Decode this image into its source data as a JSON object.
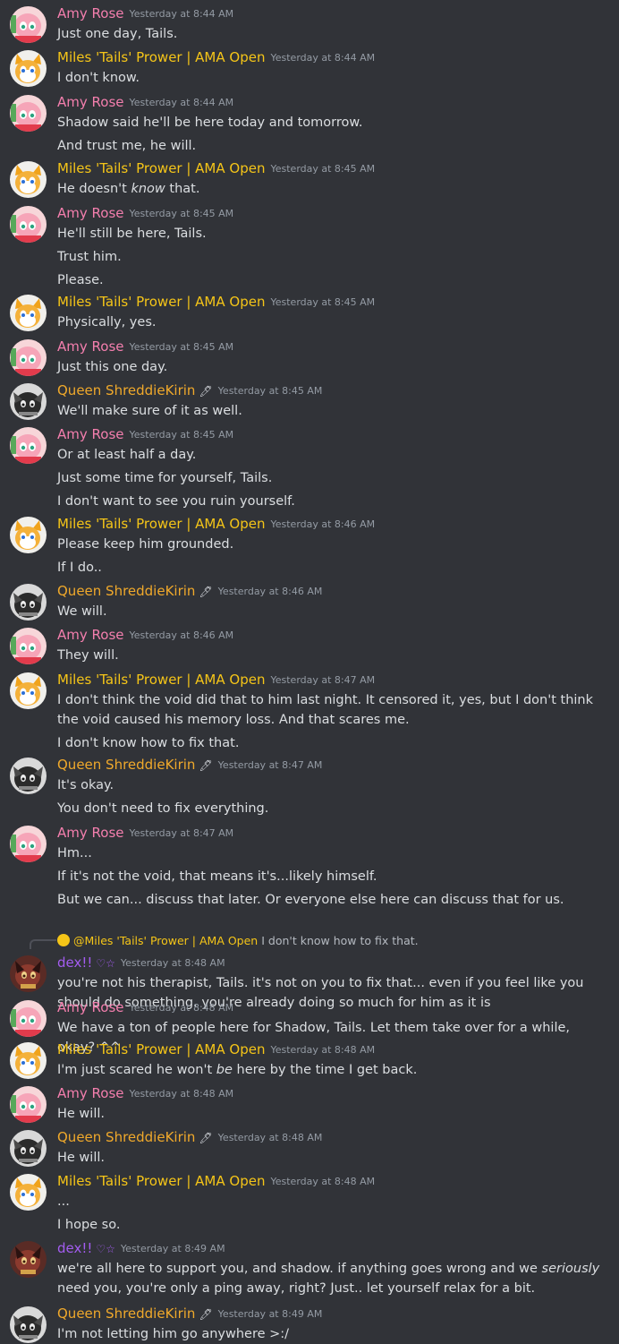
{
  "messages": [
    {
      "author": "Amy Rose",
      "role": "amy",
      "time": "Yesterday at 8:44 AM",
      "lines": [
        "Just one day, Tails."
      ]
    },
    {
      "author": "Miles 'Tails' Prower | AMA Open",
      "role": "tails",
      "time": "Yesterday at 8:44 AM",
      "lines": [
        "I don't know."
      ]
    },
    {
      "author": "Amy Rose",
      "role": "amy",
      "time": "Yesterday at 8:44 AM",
      "lines": [
        "Shadow said he'll be here today and tomorrow.",
        "And trust me, he will."
      ]
    },
    {
      "author": "Miles 'Tails' Prower | AMA Open",
      "role": "tails",
      "time": "Yesterday at 8:45 AM",
      "lines": [
        "He doesn't |know| that."
      ]
    },
    {
      "author": "Amy Rose",
      "role": "amy",
      "time": "Yesterday at 8:45 AM",
      "lines": [
        "He'll still be here, Tails.",
        "Trust him.",
        "Please."
      ]
    },
    {
      "author": "Miles 'Tails' Prower | AMA Open",
      "role": "tails",
      "time": "Yesterday at 8:45 AM",
      "lines": [
        "Physically, yes."
      ]
    },
    {
      "author": "Amy Rose",
      "role": "amy",
      "time": "Yesterday at 8:45 AM",
      "lines": [
        "Just this one day."
      ]
    },
    {
      "author": "Queen ShreddieKirin",
      "role": "queen",
      "badge": "🖊",
      "time": "Yesterday at 8:45 AM",
      "lines": [
        "We'll make sure of it as well."
      ]
    },
    {
      "author": "Amy Rose",
      "role": "amy",
      "time": "Yesterday at 8:45 AM",
      "lines": [
        "Or at least half a day.",
        "Just some time for yourself, Tails.",
        "I don't want to see you ruin yourself."
      ]
    },
    {
      "author": "Miles 'Tails' Prower | AMA Open",
      "role": "tails",
      "time": "Yesterday at 8:46 AM",
      "lines": [
        "Please keep him grounded.",
        "If I do.."
      ]
    },
    {
      "author": "Queen ShreddieKirin",
      "role": "queen",
      "badge": "🖊",
      "time": "Yesterday at 8:46 AM",
      "lines": [
        "We will."
      ]
    },
    {
      "author": "Amy Rose",
      "role": "amy",
      "time": "Yesterday at 8:46 AM",
      "lines": [
        "They will."
      ]
    },
    {
      "author": "Miles 'Tails' Prower | AMA Open",
      "role": "tails",
      "time": "Yesterday at 8:47 AM",
      "lines": [
        "I don't think the void did that to him last night. It censored it, yes, but I don't think the void caused his memory loss. And that scares me.",
        "I don't know how to fix that."
      ]
    },
    {
      "author": "Queen ShreddieKirin",
      "role": "queen",
      "badge": "🖊",
      "time": "Yesterday at 8:47 AM",
      "lines": [
        "It's okay.",
        "You don't need to fix everything."
      ]
    },
    {
      "author": "Amy Rose",
      "role": "amy",
      "time": "Yesterday at 8:47 AM",
      "lines": [
        "Hm...",
        "If it's not the void, that means it's...likely himself.",
        "But we can... discuss that later. Or everyone else here can discuss that for us."
      ]
    },
    {
      "author": "dex!!",
      "role": "dex",
      "badge": "♡☆",
      "time": "Yesterday at 8:48 AM",
      "reply": {
        "name": "@Miles 'Tails' Prower | AMA Open",
        "text": "I don't know how to fix that."
      },
      "lines": [
        "you're not his therapist, Tails. it's not on you to fix that... even if you feel like you should do something. you're already doing so much for him as it is"
      ]
    },
    {
      "author": "Amy Rose",
      "role": "amy",
      "time": "Yesterday at 8:48 AM",
      "lines": [
        "We have a ton of people here for Shadow, Tails. Let them take over for a while, okay? ^^"
      ]
    },
    {
      "author": "Miles 'Tails' Prower | AMA Open",
      "role": "tails",
      "time": "Yesterday at 8:48 AM",
      "lines": [
        "I'm just scared he won't |be| here by the time I get back."
      ]
    },
    {
      "author": "Amy Rose",
      "role": "amy",
      "time": "Yesterday at 8:48 AM",
      "lines": [
        "He will."
      ]
    },
    {
      "author": "Queen ShreddieKirin",
      "role": "queen",
      "badge": "🖊",
      "time": "Yesterday at 8:48 AM",
      "lines": [
        "He will."
      ]
    },
    {
      "author": "Miles 'Tails' Prower | AMA Open",
      "role": "tails",
      "time": "Yesterday at 8:48 AM",
      "lines": [
        "...",
        "I hope so."
      ]
    },
    {
      "author": "dex!!",
      "role": "dex",
      "badge": "♡☆",
      "time": "Yesterday at 8:49 AM",
      "lines": [
        "we're all here to support you, and shadow. if anything goes wrong and we |seriously| need you, you're only a ping away, right? Just.. let yourself relax for a bit."
      ]
    },
    {
      "author": "Queen ShreddieKirin",
      "role": "queen",
      "badge": "🖊",
      "time": "Yesterday at 8:49 AM",
      "lines": [
        "I'm not letting him go anywhere >:/"
      ]
    }
  ]
}
